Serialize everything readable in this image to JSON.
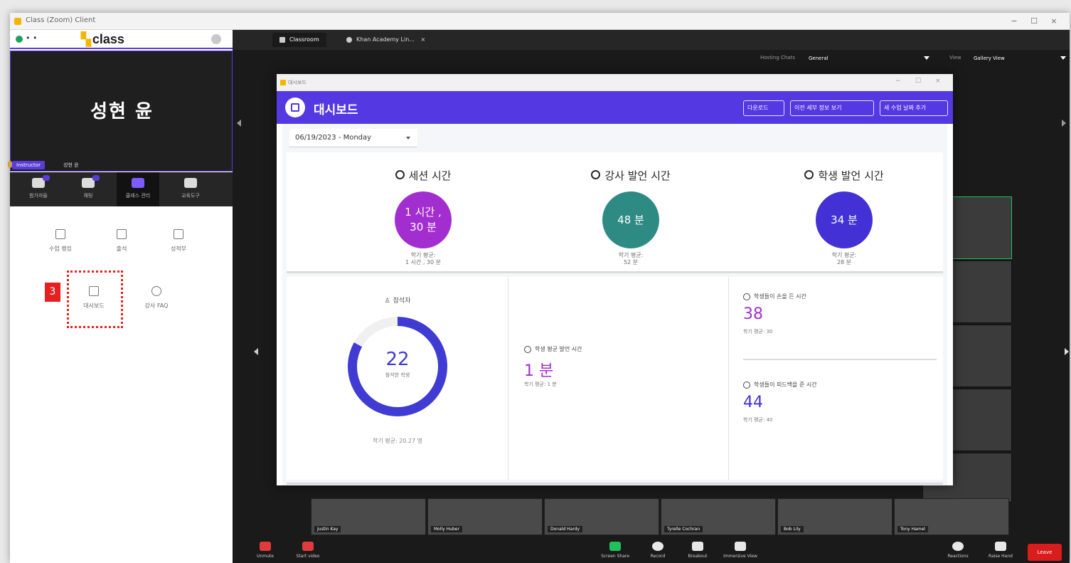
{
  "window": {
    "title": "Class (Zoom) Client",
    "min": "−",
    "max": "☐",
    "close": "×"
  },
  "sidebar": {
    "brand": "class",
    "dots": "• •",
    "user_name": "성현 윤",
    "user_tag": "Instructor",
    "user_tag_name": "성현 윤",
    "tool_tabs": [
      {
        "label": "참가자들"
      },
      {
        "label": "채팅"
      },
      {
        "label": "클래스 관리"
      },
      {
        "label": "교육도구"
      }
    ],
    "menu": [
      {
        "label": "수업 랭킹"
      },
      {
        "label": "출석"
      },
      {
        "label": "성적부"
      },
      {
        "label": "대시보드"
      },
      {
        "label": "강사 FAQ"
      }
    ],
    "step_number": "3"
  },
  "main": {
    "tabs": [
      {
        "label": "Classroom"
      },
      {
        "label": "Khan Academy Lin..."
      }
    ],
    "tab_close": "×",
    "hosting_label": "Hosting Chats",
    "hosting_value": "General",
    "view_label": "View",
    "view_value": "Gallery View",
    "participants": [
      "Justin Kay",
      "Molly Huber",
      "Donald Hardy",
      "Tyrelle Cochran",
      "Bob Lily",
      "Tony Hamel"
    ],
    "controls": [
      "Unmute",
      "Start video",
      "Screen Share",
      "Record",
      "Breakout",
      "Immersive View",
      "Reactions",
      "Raise Hand"
    ],
    "leave": "Leave"
  },
  "dashboard": {
    "window_title": "대시보드",
    "title": "대시보드",
    "buttons": [
      "다운로드",
      "이전 세부 정보 보기",
      "세 수업 날짜 추가"
    ],
    "date": "06/19/2023 - Monday",
    "stats": [
      {
        "title": "세션 시간",
        "value": "1 시간 ,\n30 분",
        "avg": "학기 평균:\n1 시간 , 30 분",
        "color": "#a32ed0"
      },
      {
        "title": "강사 발언 시간",
        "value": "48 분",
        "avg": "학기 평균:\n52 분",
        "color": "#2e8b83"
      },
      {
        "title": "학생 발언 시간",
        "value": "34 분",
        "avg": "학기 평균:\n28 분",
        "color": "#4331d6"
      }
    ],
    "attendance": {
      "title": "참석자",
      "value": "22",
      "sub": "참석한 학생",
      "avg": "학기 평균: 20.27 명",
      "fraction": 0.83
    },
    "avg_speaking": {
      "title": "학생 평균 발언 시간",
      "value": "1 분",
      "avg": "학기 평균: 1 분"
    },
    "hand_raise": {
      "title": "학생들이 손을 든 시간",
      "value": "38",
      "avg": "학기 평균: 30"
    },
    "feedback": {
      "title": "학생들이 피드백을 준 시간",
      "value": "44",
      "avg": "학기 평균: 40"
    }
  },
  "colors": {
    "accent": "#5438e2",
    "highlight": "#e62020",
    "purple_text": "#a32ed0",
    "indigo_text": "#4331d6"
  }
}
